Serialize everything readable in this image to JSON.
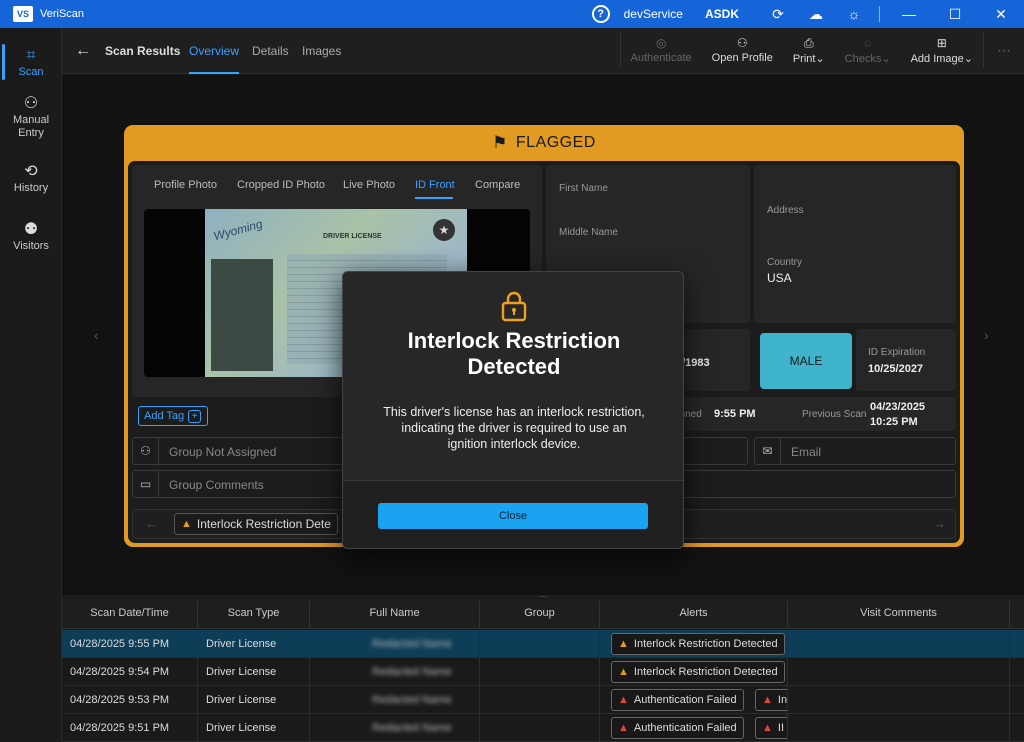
{
  "app": {
    "logo": "VS",
    "name": "VeriScan"
  },
  "titlebar": {
    "help_icon": "?",
    "service": "devService",
    "sdk": "ASDK",
    "icons": [
      "sync-icon",
      "cloud-icon",
      "brightness-icon"
    ],
    "window": {
      "minimize": "—",
      "maximize": "☐",
      "close": "✕"
    }
  },
  "nav": {
    "items": [
      {
        "label": "Scan",
        "icon": "scan-icon",
        "glyph": "⌗"
      },
      {
        "label": "Manual Entry",
        "icon": "manual-entry-icon",
        "glyph": "⚇"
      },
      {
        "label": "History",
        "icon": "history-icon",
        "glyph": "⟲"
      },
      {
        "label": "Visitors",
        "icon": "visitors-icon",
        "glyph": "⚉"
      }
    ]
  },
  "header": {
    "back_glyph": "←",
    "title": "Scan Results",
    "tabs": [
      "Overview",
      "Details",
      "Images"
    ],
    "tools": [
      {
        "label": "Authenticate",
        "glyph": "◎",
        "disabled": true
      },
      {
        "label": "Open Profile",
        "glyph": "⚇",
        "disabled": false
      },
      {
        "label": "Print⌄",
        "glyph": "⎙",
        "disabled": false
      },
      {
        "label": "Checks⌄",
        "glyph": "◌",
        "disabled": true
      },
      {
        "label": "Add Image⌄",
        "glyph": "⊞",
        "disabled": false
      }
    ],
    "more": "⋯"
  },
  "card": {
    "status": "FLAGGED",
    "flag_glyph": "⚑",
    "photo_tabs": [
      "Profile Photo",
      "Cropped ID Photo",
      "Live Photo",
      "ID Front",
      "Compare"
    ],
    "license": {
      "state": "Wyoming",
      "title": "DRIVER LICENSE",
      "seal": "★"
    },
    "fields": {
      "first_name_label": "First Name",
      "middle_name_label": "Middle Name",
      "address_label": "Address",
      "country_label": "Country",
      "country_value": "USA",
      "dob_partial": "5/1983",
      "sex": "MALE",
      "id_exp_label": "ID Expiration",
      "id_exp_value": "10/25/2027",
      "scanned_label": "anned",
      "scanned_value": "9:55 PM",
      "prev_scan_label": "Previous Scan",
      "prev_scan_date": "04/23/2025",
      "prev_scan_time": "10:25 PM"
    },
    "add_tag": "Add Tag",
    "group": "Group Not Assigned",
    "group_comments": "Group Comments",
    "email": "Email",
    "alert_chip": "Interlock Restriction Dete",
    "prev_glyph": "←",
    "next_glyph": "→",
    "edge_left": "‹",
    "edge_right": "›"
  },
  "table": {
    "columns": [
      "Scan Date/Time",
      "Scan Type",
      "Full Name",
      "Group",
      "Alerts",
      "Visit Comments"
    ],
    "rows": [
      {
        "datetime": "04/28/2025 9:55 PM",
        "type": "Driver License",
        "name": "Redacted Name",
        "alerts": [
          "Interlock Restriction Detected"
        ],
        "alert_colors": [
          "amber"
        ],
        "selected": true
      },
      {
        "datetime": "04/28/2025 9:54 PM",
        "type": "Driver License",
        "name": "Redacted Name",
        "alerts": [
          "Interlock Restriction Detected"
        ],
        "alert_colors": [
          "amber"
        ],
        "selected": false
      },
      {
        "datetime": "04/28/2025 9:53 PM",
        "type": "Driver License",
        "name": "Redacted Name",
        "alerts": [
          "Authentication Failed",
          "In"
        ],
        "alert_colors": [
          "red",
          "red"
        ],
        "selected": false
      },
      {
        "datetime": "04/28/2025 9:51 PM",
        "type": "Driver License",
        "name": "Redacted Name",
        "alerts": [
          "Authentication Failed",
          "II"
        ],
        "alert_colors": [
          "red",
          "red"
        ],
        "selected": false
      }
    ]
  },
  "modal": {
    "icon": "lock-icon",
    "title": "Interlock Restriction Detected",
    "body": "This driver's license has an interlock restriction, indicating the driver is required to use an ignition interlock device.",
    "button": "Close"
  },
  "colors": {
    "accent": "#3aa0ff",
    "flag": "#e19a22",
    "titlebar": "#1565d8",
    "selected_row": "#0d3d57",
    "male": "#3fb4cc",
    "modal_button": "#1aa3f0"
  }
}
